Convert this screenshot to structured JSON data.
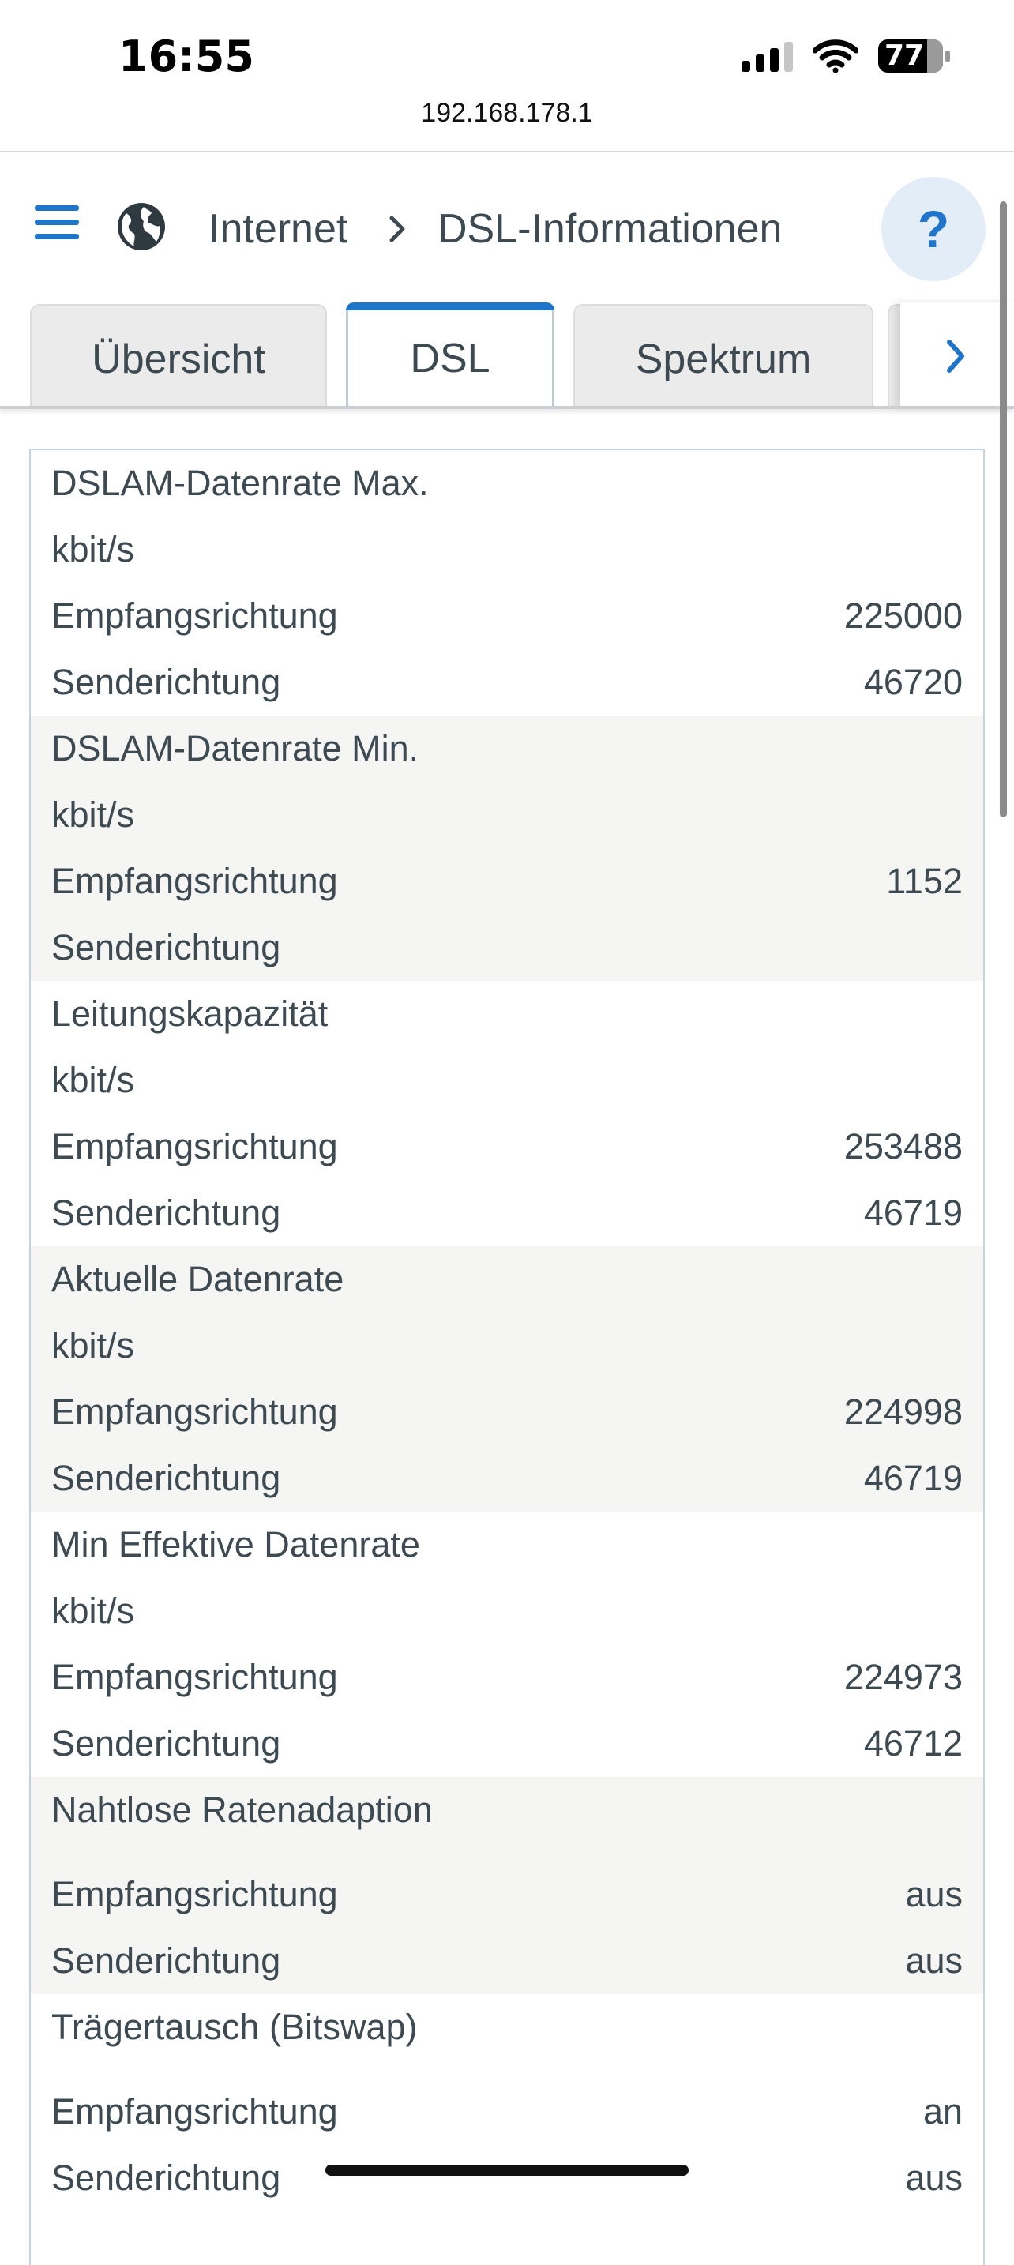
{
  "status_bar": {
    "time": "16:55",
    "battery": "77"
  },
  "browser": {
    "url": "192.168.178.1"
  },
  "header": {
    "breadcrumb_parent": "Internet",
    "breadcrumb_current": "DSL-Informationen",
    "help": "?"
  },
  "tabs": [
    {
      "label": "Übersicht"
    },
    {
      "label": "DSL"
    },
    {
      "label": "Spektrum"
    }
  ],
  "table": {
    "groups": [
      {
        "title": "DSLAM-Datenrate Max.",
        "unit": "kbit/s",
        "rows": [
          {
            "label": "Empfangsrichtung",
            "value": "225000"
          },
          {
            "label": "Senderichtung",
            "value": "46720"
          }
        ]
      },
      {
        "title": "DSLAM-Datenrate Min.",
        "unit": "kbit/s",
        "rows": [
          {
            "label": "Empfangsrichtung",
            "value": "1152"
          },
          {
            "label": "Senderichtung",
            "value": ""
          }
        ]
      },
      {
        "title": "Leitungskapazität",
        "unit": "kbit/s",
        "rows": [
          {
            "label": "Empfangsrichtung",
            "value": "253488"
          },
          {
            "label": "Senderichtung",
            "value": "46719"
          }
        ]
      },
      {
        "title": "Aktuelle Datenrate",
        "unit": "kbit/s",
        "rows": [
          {
            "label": "Empfangsrichtung",
            "value": "224998"
          },
          {
            "label": "Senderichtung",
            "value": "46719"
          }
        ]
      },
      {
        "title": "Min Effektive Datenrate",
        "unit": "kbit/s",
        "rows": [
          {
            "label": "Empfangsrichtung",
            "value": "224973"
          },
          {
            "label": "Senderichtung",
            "value": "46712"
          }
        ]
      },
      {
        "title": "Nahtlose Ratenadaption",
        "unit": "",
        "rows": [
          {
            "label": "Empfangsrichtung",
            "value": "aus"
          },
          {
            "label": "Senderichtung",
            "value": "aus"
          }
        ]
      },
      {
        "title": "Trägertausch (Bitswap)",
        "unit": "",
        "rows": [
          {
            "label": "Empfangsrichtung",
            "value": "an"
          },
          {
            "label": "Senderichtung",
            "value": "aus"
          }
        ]
      }
    ]
  }
}
